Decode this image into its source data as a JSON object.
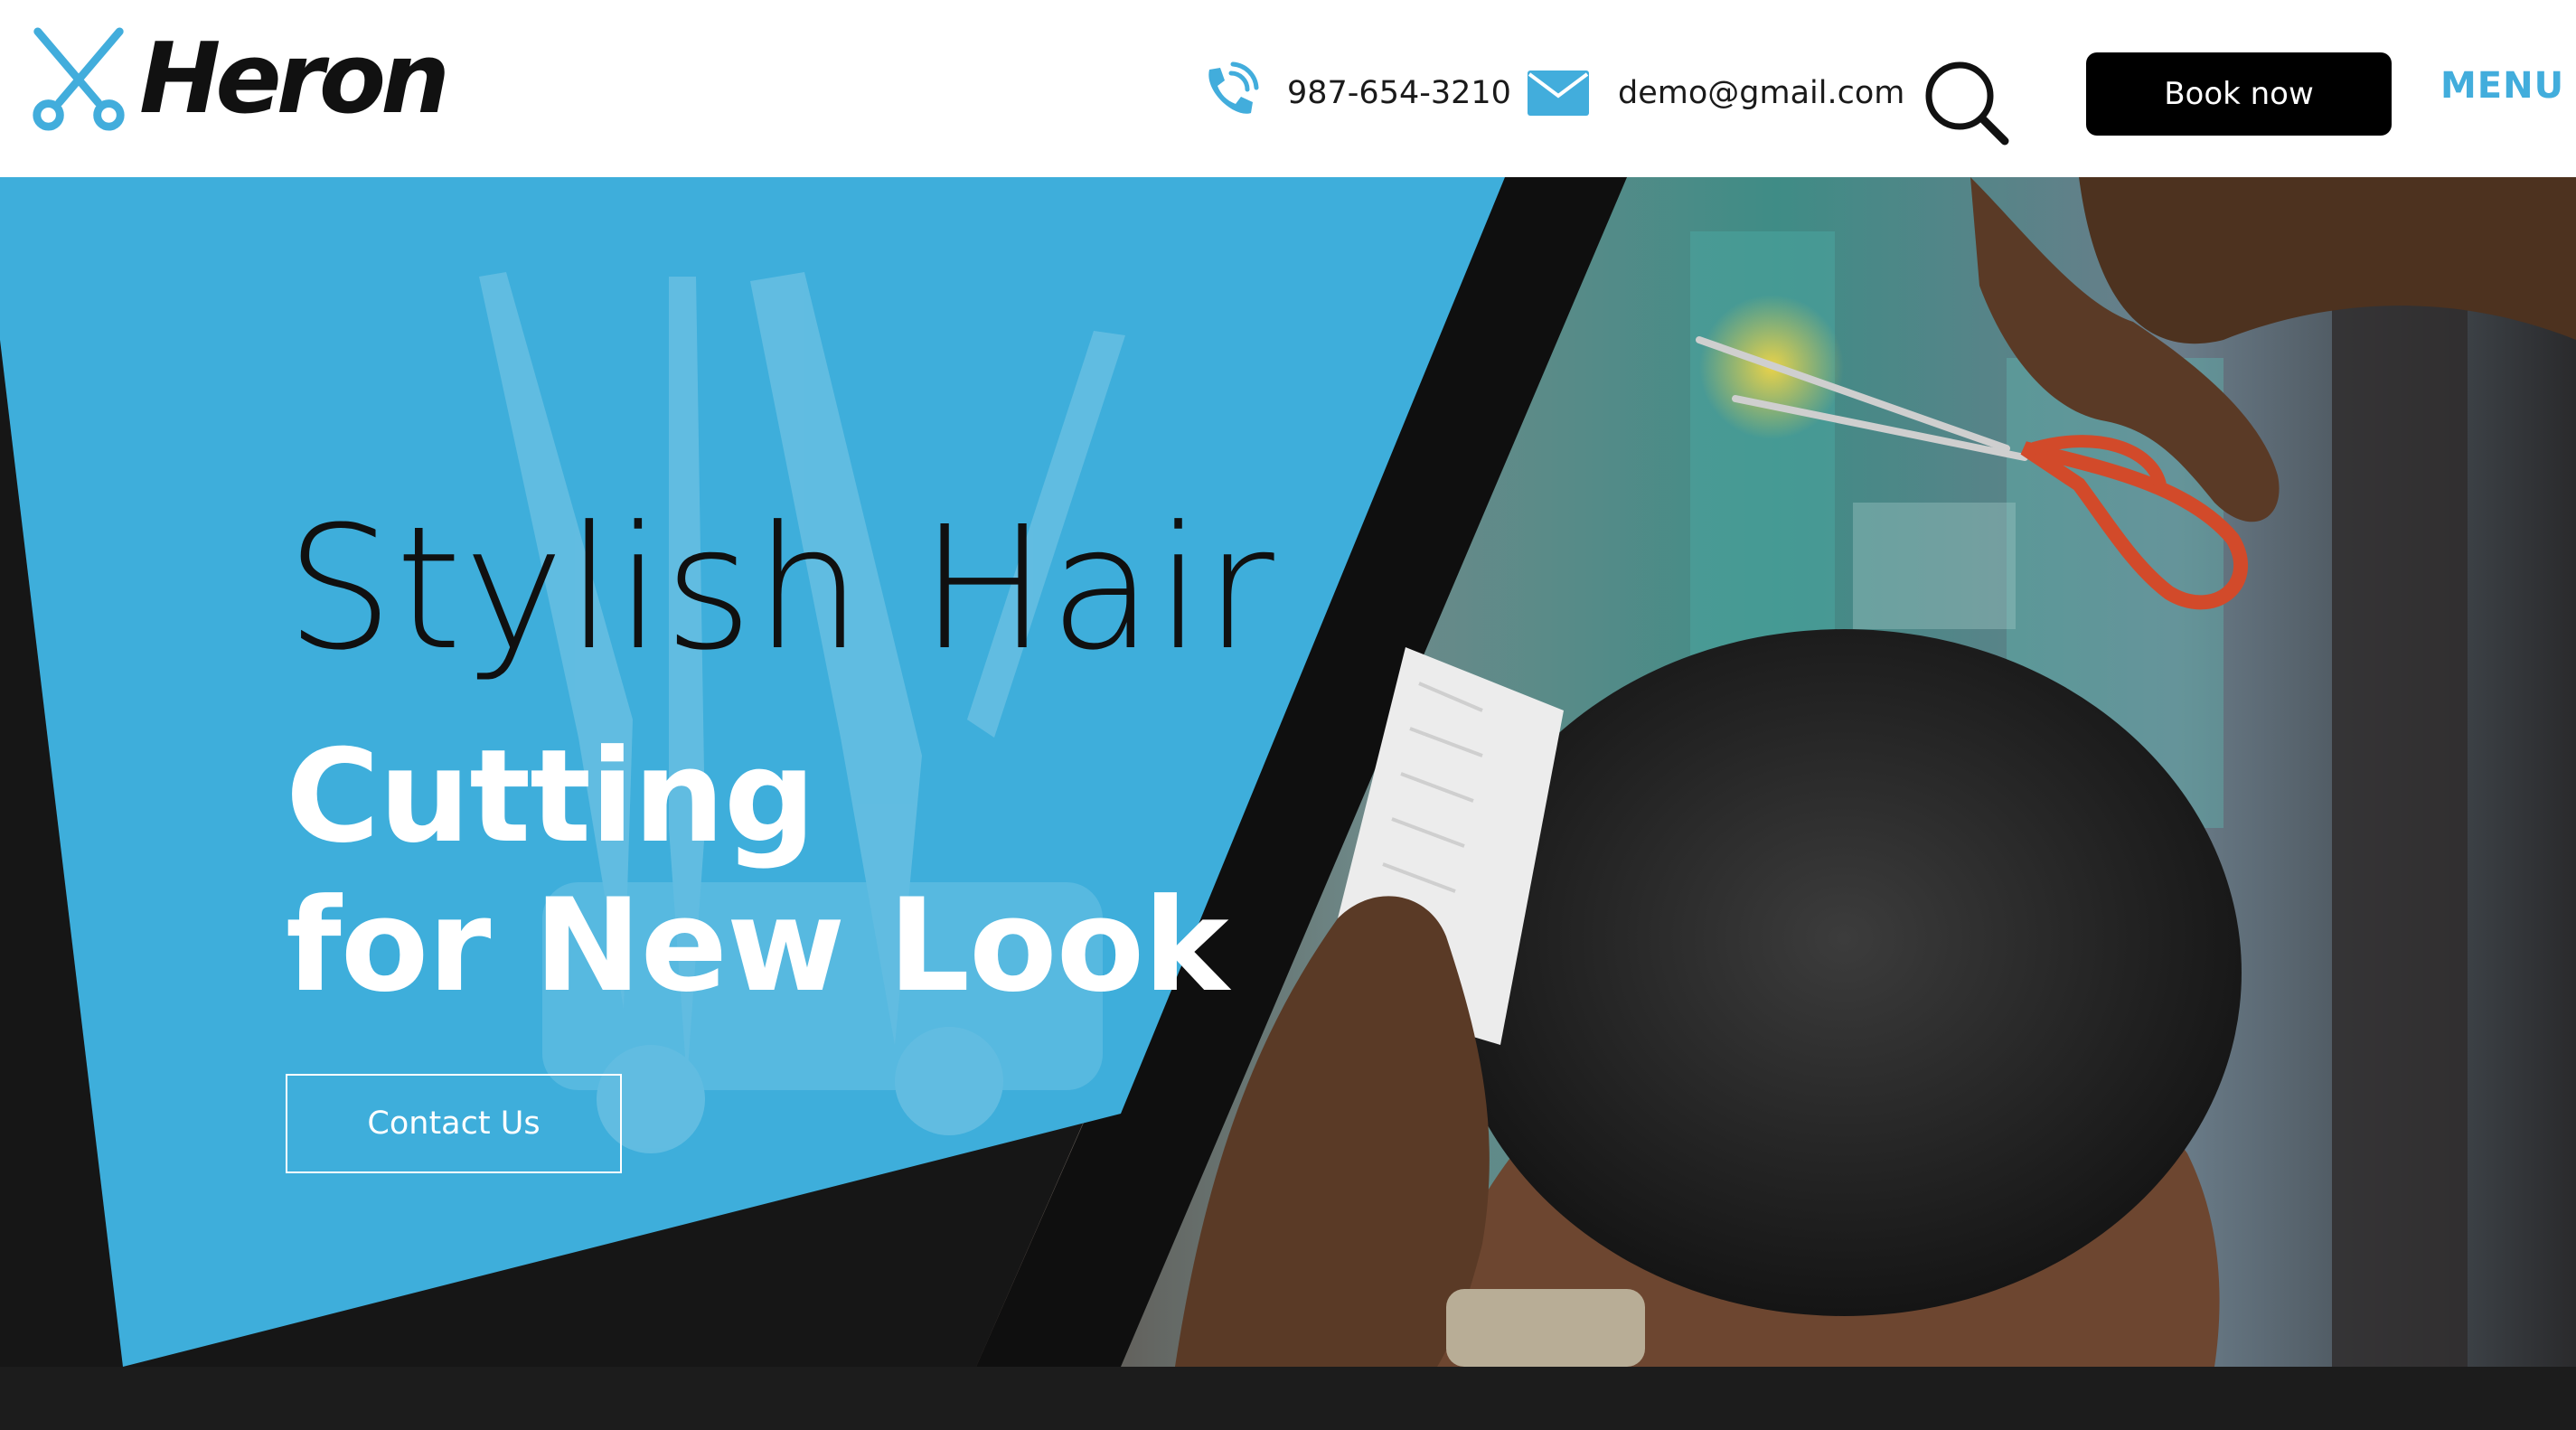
{
  "brand": {
    "name": "Heron",
    "accent_color": "#42addc"
  },
  "header": {
    "phone": {
      "icon": "phone-ring-icon",
      "text": "987-654-3210"
    },
    "email": {
      "icon": "envelope-icon",
      "text": "demo@gmail.com"
    },
    "search": {
      "icon": "search-icon"
    },
    "book_label": "Book now",
    "menu_label": "MENU"
  },
  "hero": {
    "title_thin": "Stylish Hair",
    "title_bold_line1": "Cutting",
    "title_bold_line2": "for New Look",
    "cta_label": "Contact Us",
    "panel_color": "#3eaedb",
    "image": "barber-cutting-hair-photo"
  }
}
